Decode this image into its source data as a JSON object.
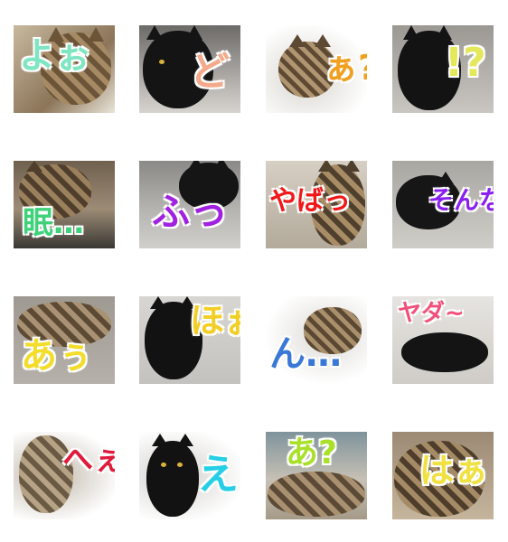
{
  "stickers": [
    {
      "caption": "よぉ",
      "color": "#7fe6c2",
      "cat": "tabby",
      "bg": "#b9ab93"
    },
    {
      "caption": "ど",
      "color": "#f3a98a",
      "cat": "black",
      "bg": "#a9a6a3"
    },
    {
      "caption": "ぁ?",
      "color": "#f0a020",
      "cat": "tabby",
      "bg": "#f2f2f2"
    },
    {
      "caption": "!?",
      "color": "#e4e85a",
      "cat": "black",
      "bg": "#b7b4af"
    },
    {
      "caption": "眠…",
      "color": "#3fd27a",
      "cat": "tabby",
      "bg": "#8c7b67"
    },
    {
      "caption": "ふっ",
      "color": "#a021e0",
      "cat": "black",
      "bg": "#9f9e9b"
    },
    {
      "caption": "やばっ",
      "color": "#f01818",
      "cat": "tabby",
      "bg": "#c9c2b6"
    },
    {
      "caption": "そんな",
      "color": "#8a1ff0",
      "cat": "black",
      "bg": "#b4b2ad"
    },
    {
      "caption": "あぅ",
      "color": "#f3dc2a",
      "cat": "tabby",
      "bg": "#a7a39b"
    },
    {
      "caption": "ほぉ",
      "color": "#f2cf26",
      "cat": "black",
      "bg": "#cfcdc9"
    },
    {
      "caption": "ん…",
      "color": "#3a78d8",
      "cat": "tabby",
      "bg": "#e7e6e3"
    },
    {
      "caption": "ヤダ~",
      "color": "#f0507a",
      "cat": "black",
      "bg": "#d9d7d3"
    },
    {
      "caption": "へぇ",
      "color": "#e01a3a",
      "cat": "tabby",
      "bg": "#efefee"
    },
    {
      "caption": "え",
      "color": "#27cfe6",
      "cat": "black",
      "bg": "#efefee"
    },
    {
      "caption": "あ?",
      "color": "#a8e02a",
      "cat": "tabby",
      "bg": "#8fa0a8"
    },
    {
      "caption": "はぁ",
      "color": "#f0e040",
      "cat": "tabby",
      "bg": "#a89580"
    }
  ]
}
